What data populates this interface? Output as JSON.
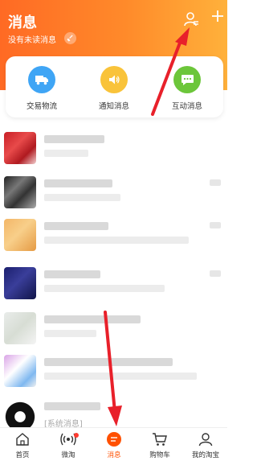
{
  "header": {
    "title": "消息",
    "subtitle": "没有未读消息"
  },
  "categories": [
    {
      "label": "交易物流",
      "icon": "truck-icon",
      "color": "#3fa5f5"
    },
    {
      "label": "通知消息",
      "icon": "speaker-icon",
      "color": "#f9c33a"
    },
    {
      "label": "互动消息",
      "icon": "chat-bubble-icon",
      "color": "#6cc63a"
    }
  ],
  "messages": {
    "system_label": "[系统消息]"
  },
  "tabbar": {
    "items": [
      {
        "label": "首页",
        "icon": "home-icon",
        "active": false
      },
      {
        "label": "微淘",
        "icon": "broadcast-icon",
        "active": false
      },
      {
        "label": "消息",
        "icon": "message-icon",
        "active": true
      },
      {
        "label": "购物车",
        "icon": "cart-icon",
        "active": false
      },
      {
        "label": "我的淘宝",
        "icon": "user-icon",
        "active": false
      }
    ]
  },
  "colors": {
    "header_start": "#ff6a24",
    "header_end": "#ffb13b",
    "active_tab": "#ff5000",
    "arrow": "#e8202a"
  }
}
